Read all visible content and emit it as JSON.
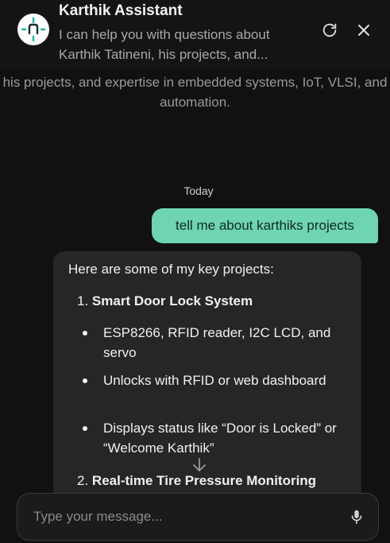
{
  "header": {
    "title": "Karthik Assistant",
    "subtitle": "I can help you with questions about Karthik Tatineni, his projects, and...",
    "avatar_icon": "netlify-n-icon",
    "refresh_icon": "refresh-icon",
    "close_icon": "close-icon"
  },
  "intro_text": "his projects, and expertise in embedded systems, IoT, VLSI, and automation.",
  "date_separator": "Today",
  "messages": {
    "user": "tell me about karthiks projects",
    "bot": {
      "intro": "Here are some of my key projects:",
      "projects": [
        {
          "number": "1.",
          "title": "Smart Door Lock System",
          "bullets": [
            "ESP8266, RFID reader, I2C LCD, and servo",
            "Unlocks with RFID or web dashboard",
            "Displays status like “Door is Locked” or “Welcome Karthik”"
          ]
        },
        {
          "number": "2.",
          "title": "Real-time Tire Pressure Monitoring",
          "bullets": []
        }
      ]
    }
  },
  "composer": {
    "placeholder": "Type your message...",
    "mic_icon": "microphone-icon"
  },
  "colors": {
    "background": "#111111",
    "user_bubble": "#6fd4b0",
    "bot_bubble": "#262626",
    "avatar_accent": "#1fb5a6"
  }
}
